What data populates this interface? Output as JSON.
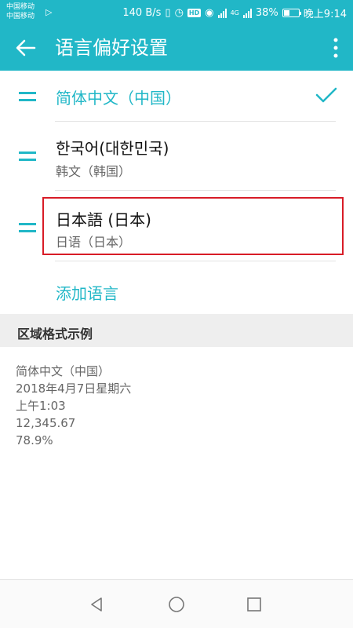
{
  "status_bar": {
    "carrier1": "中国移动",
    "carrier2": "中国移动",
    "speed": "140 B/s",
    "network": "4G",
    "battery_pct": "38%",
    "time": "晚上9:14"
  },
  "toolbar": {
    "title": "语言偏好设置",
    "back_icon": "arrow-left",
    "more_icon": "vertical-dots"
  },
  "languages": [
    {
      "title": "简体中文（中国）",
      "subtitle": "",
      "selected": true
    },
    {
      "title": "한국어(대한민국)",
      "subtitle": "韩文（韩国）",
      "selected": false
    },
    {
      "title": "日本語 (日本)",
      "subtitle": "日语（日本）",
      "selected": false,
      "highlighted": true
    }
  ],
  "add_language_label": "添加语言",
  "region_section": {
    "title": "区域格式示例",
    "lines": [
      "简体中文（中国）",
      "2018年4月7日星期六",
      "上午1:03",
      "12,345.67",
      "78.9%"
    ]
  },
  "colors": {
    "accent": "#21b7c7",
    "highlight_border": "#d81c27"
  }
}
